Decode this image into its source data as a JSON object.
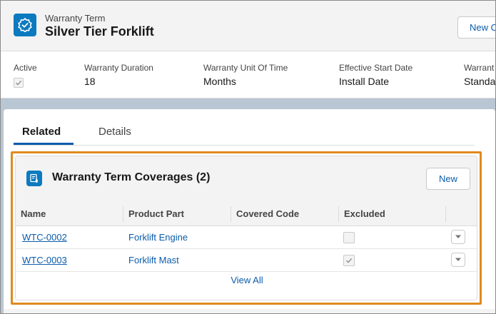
{
  "header": {
    "object_type": "Warranty Term",
    "record_title": "Silver Tier Forklift",
    "new_button_label": "New C",
    "record_icon": "warranty-term-icon"
  },
  "highlights": {
    "fields": [
      {
        "label": "Active",
        "value": "",
        "checked": true
      },
      {
        "label": "Warranty Duration",
        "value": "18"
      },
      {
        "label": "Warranty Unit Of Time",
        "value": "Months"
      },
      {
        "label": "Effective Start Date",
        "value": "Install Date"
      },
      {
        "label": "Warrant",
        "value": "Standa"
      }
    ]
  },
  "tabs": [
    {
      "label": "Related",
      "active": true
    },
    {
      "label": "Details",
      "active": false
    }
  ],
  "related_list": {
    "title": "Warranty Term Coverages (2)",
    "icon": "warranty-coverage-icon",
    "new_button_label": "New",
    "columns": [
      "Name",
      "Product Part",
      "Covered Code",
      "Excluded"
    ],
    "rows": [
      {
        "name": "WTC-0002",
        "product_part": "Forklift Engine",
        "covered_code": "",
        "excluded": false
      },
      {
        "name": "WTC-0003",
        "product_part": "Forklift Mast",
        "covered_code": "",
        "excluded": true
      }
    ],
    "view_all_label": "View All"
  },
  "colors": {
    "brand_blue": "#0b7abf",
    "link_blue": "#0b5cab",
    "highlight_orange": "#e08a1e"
  }
}
